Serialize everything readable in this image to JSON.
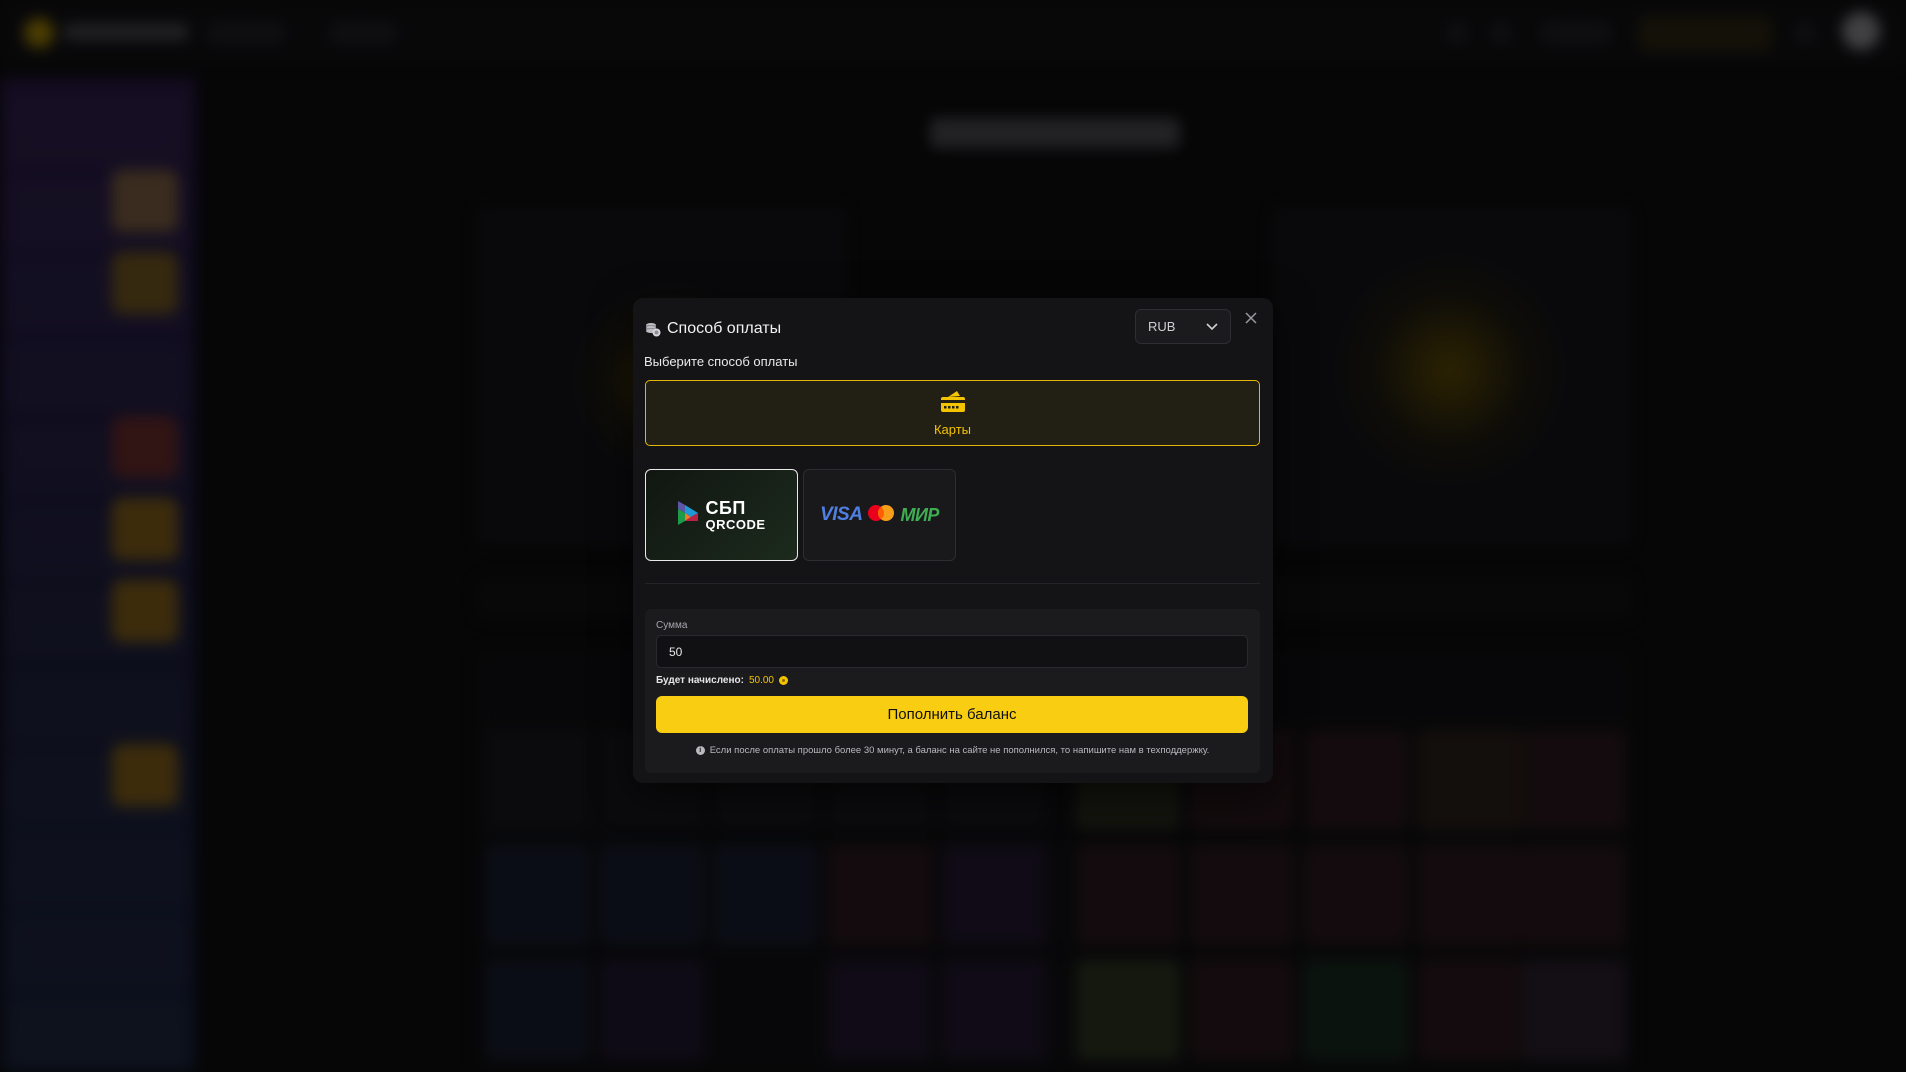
{
  "modal": {
    "title": "Способ оплаты",
    "title_icon": "coins-icon",
    "currency": {
      "selected": "RUB",
      "icon": "chevron-down-icon"
    },
    "close_icon": "close-icon",
    "subtitle": "Выберите способ оплаты",
    "method_tabs": [
      {
        "label": "Карты",
        "icon": "card-wallet-icon",
        "active": true
      }
    ],
    "providers": [
      {
        "name_line1": "СБП",
        "name_line2": "QRCODE",
        "selected": true
      },
      {
        "logos": [
          "VISA",
          "mastercard",
          "МИР"
        ],
        "selected": false
      }
    ],
    "amount": {
      "label": "Сумма",
      "value": "50"
    },
    "credit": {
      "label": "Будет начислено:",
      "value": "50.00",
      "icon": "coin-icon"
    },
    "submit_label": "Пополнить баланс",
    "note": "Если после оплаты прошло более 30 минут, а баланс на сайте не пополнился, то напишите нам в техподдержку.",
    "note_icon": "info-icon"
  },
  "colors": {
    "accent": "#f8cd12",
    "modal_bg": "#141416",
    "tab_bg": "#221f15",
    "page_bg": "#0b0b0d"
  }
}
